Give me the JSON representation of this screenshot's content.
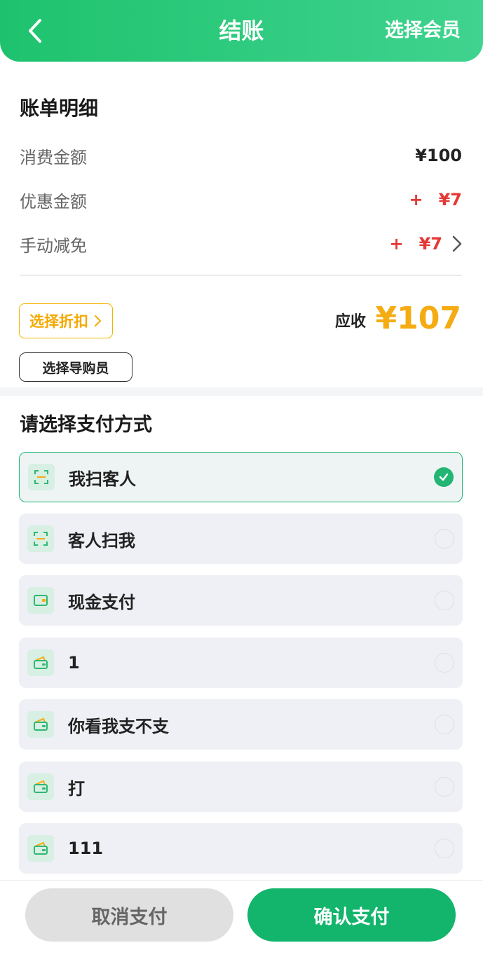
{
  "header": {
    "title": "结账",
    "right_action": "选择会员"
  },
  "bill": {
    "title": "账单明细",
    "rows": [
      {
        "label": "消费金额",
        "value": "¥100"
      },
      {
        "label": "优惠金额",
        "sign": "+",
        "value": "¥7"
      },
      {
        "label": "手动减免",
        "sign": "+",
        "value": "¥7"
      }
    ],
    "discount_button": "选择折扣",
    "due_label": "应收",
    "due_value": "¥107",
    "guide_button": "选择导购员"
  },
  "payment": {
    "title": "请选择支付方式",
    "methods": [
      {
        "label": "我扫客人",
        "icon": "scan-icon",
        "selected": true
      },
      {
        "label": "客人扫我",
        "icon": "scan-icon",
        "selected": false
      },
      {
        "label": "现金支付",
        "icon": "cash-icon",
        "selected": false
      },
      {
        "label": "1",
        "icon": "wallet-icon",
        "selected": false
      },
      {
        "label": "你看我支不支",
        "icon": "wallet-icon",
        "selected": false
      },
      {
        "label": "打",
        "icon": "wallet-icon",
        "selected": false
      },
      {
        "label": "111",
        "icon": "wallet-icon",
        "selected": false
      }
    ]
  },
  "footer": {
    "cancel": "取消支付",
    "confirm": "确认支付"
  },
  "colors": {
    "brand_green": "#1ec26d",
    "accent_orange": "#f4ac12",
    "red": "#e53935"
  }
}
